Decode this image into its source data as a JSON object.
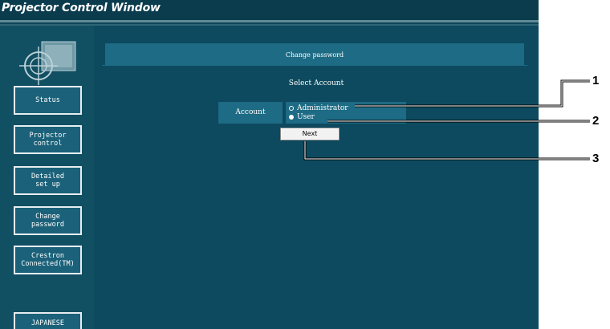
{
  "window": {
    "title": "Projector Control Window"
  },
  "sidebar": {
    "items": [
      {
        "label": "Status"
      },
      {
        "label": "Projector\ncontrol"
      },
      {
        "label": "Detailed\nset up"
      },
      {
        "label": "Change\npassword"
      },
      {
        "label": "Crestron\nConnected(TM)"
      },
      {
        "label": "JAPANESE"
      }
    ]
  },
  "main": {
    "panel_title": "Change password",
    "section_title": "Select Account",
    "account_label": "Account",
    "options": [
      {
        "label": "Administrator",
        "selected": false
      },
      {
        "label": "User",
        "selected": true
      }
    ],
    "next_label": "Next"
  },
  "callouts": [
    "1",
    "2",
    "3"
  ]
}
